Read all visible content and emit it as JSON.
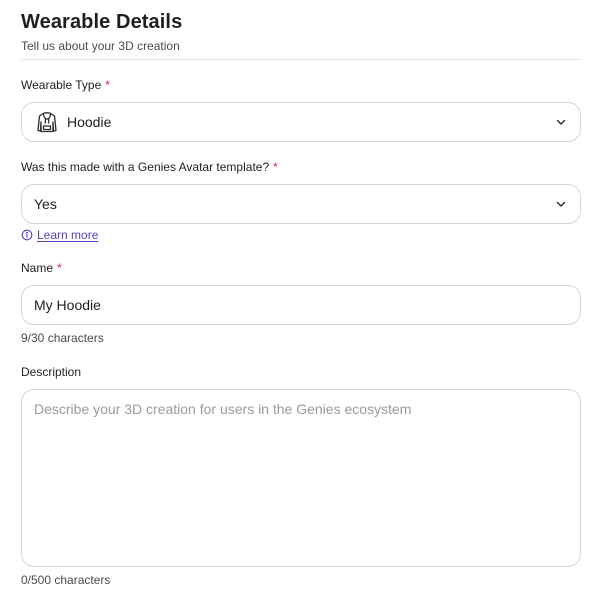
{
  "header": {
    "title": "Wearable Details",
    "subtitle": "Tell us about your 3D creation"
  },
  "wearable_type": {
    "label": "Wearable Type",
    "required_mark": "*",
    "value": "Hoodie",
    "icon": "hoodie-icon"
  },
  "template": {
    "label": "Was this made with a Genies Avatar template?",
    "required_mark": "*",
    "value": "Yes",
    "learn_more": "Learn more"
  },
  "name": {
    "label": "Name",
    "required_mark": "*",
    "value": "My Hoodie",
    "counter": "9/30 characters"
  },
  "description": {
    "label": "Description",
    "placeholder": "Describe your 3D creation for users in the Genies ecosystem",
    "value": "",
    "counter": "0/500 characters"
  },
  "colors": {
    "required": "#e0243f",
    "link": "#5b3ec4",
    "border": "#d6d6db"
  }
}
